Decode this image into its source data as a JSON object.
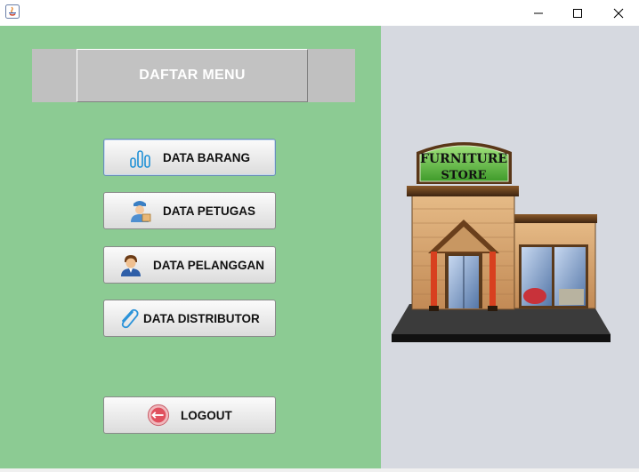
{
  "window": {
    "controls": [
      "minimize",
      "maximize",
      "close"
    ]
  },
  "menu": {
    "title": "DAFTAR MENU",
    "buttons": [
      {
        "label": "DATA BARANG",
        "icon": "bar-chart-icon"
      },
      {
        "label": "DATA PETUGAS",
        "icon": "courier-icon"
      },
      {
        "label": "DATA PELANGGAN",
        "icon": "customer-icon"
      },
      {
        "label": "DATA DISTRIBUTOR",
        "icon": "paperclip-icon"
      }
    ],
    "logout": {
      "label": "LOGOUT",
      "icon": "logout-icon"
    }
  },
  "illustration": {
    "sign_line1": "FURNITURE",
    "sign_line2": "STORE"
  },
  "colors": {
    "left_panel": "#8ccb93",
    "right_panel": "#d6d9e0",
    "header_bg": "#c0c0c0"
  }
}
